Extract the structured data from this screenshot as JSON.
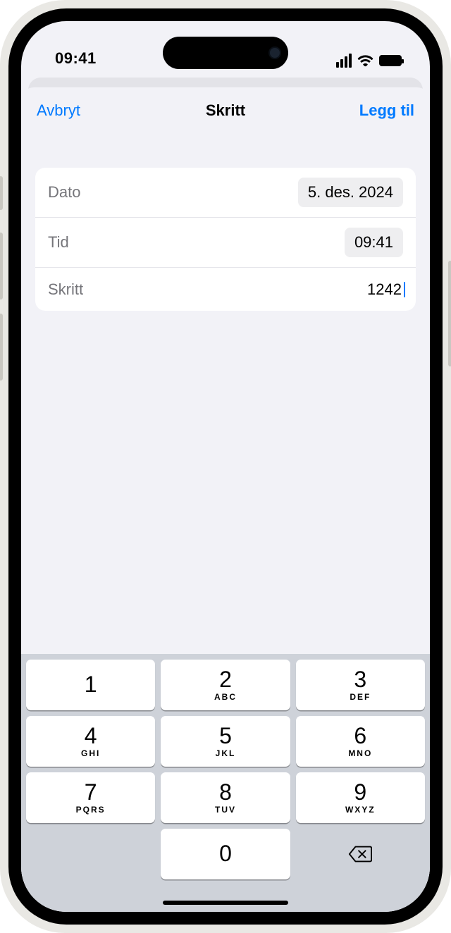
{
  "status": {
    "time": "09:41"
  },
  "nav": {
    "cancel": "Avbryt",
    "title": "Skritt",
    "add": "Legg til"
  },
  "form": {
    "date_label": "Dato",
    "date_value": "5. des. 2024",
    "time_label": "Tid",
    "time_value": "09:41",
    "steps_label": "Skritt",
    "steps_value": "1242"
  },
  "keypad": {
    "k1": {
      "d": "1",
      "l": ""
    },
    "k2": {
      "d": "2",
      "l": "ABC"
    },
    "k3": {
      "d": "3",
      "l": "DEF"
    },
    "k4": {
      "d": "4",
      "l": "GHI"
    },
    "k5": {
      "d": "5",
      "l": "JKL"
    },
    "k6": {
      "d": "6",
      "l": "MNO"
    },
    "k7": {
      "d": "7",
      "l": "PQRS"
    },
    "k8": {
      "d": "8",
      "l": "TUV"
    },
    "k9": {
      "d": "9",
      "l": "WXYZ"
    },
    "k0": {
      "d": "0",
      "l": ""
    }
  }
}
